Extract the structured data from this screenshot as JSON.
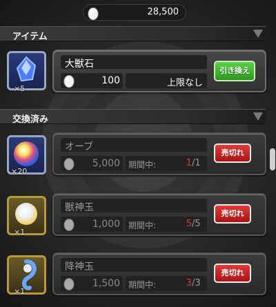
{
  "currency": {
    "amount": "28,500",
    "icon": "egg-icon"
  },
  "sections": {
    "items": "アイテム",
    "exchanged": "交換済み"
  },
  "available": [
    {
      "name": "大獣石",
      "price": "100",
      "limit": "上限なし",
      "count": "×5",
      "button": "引き換え",
      "icon": "blue-crystal-icon"
    }
  ],
  "exchanged": [
    {
      "name": "オーブ",
      "price": "5,000",
      "period_label": "期間中:",
      "period_now": "1",
      "period_max": "/1",
      "count": "×20",
      "button": "売切れ",
      "icon": "orb-icon"
    },
    {
      "name": "獣神玉",
      "price": "1,000",
      "period_label": "期間中:",
      "period_now": "5",
      "period_max": "/5",
      "count": "×1",
      "button": "売切れ",
      "icon": "beast-orb-icon"
    },
    {
      "name": "降神玉",
      "price": "1,500",
      "period_label": "期間中:",
      "period_now": "3",
      "period_max": "/3",
      "count": "×1",
      "button": "売切れ",
      "icon": "descent-orb-icon"
    }
  ],
  "colors": {
    "accent_green": "#3cb82c",
    "soldout_red": "#c42020",
    "counter_red": "#d83b3b"
  }
}
